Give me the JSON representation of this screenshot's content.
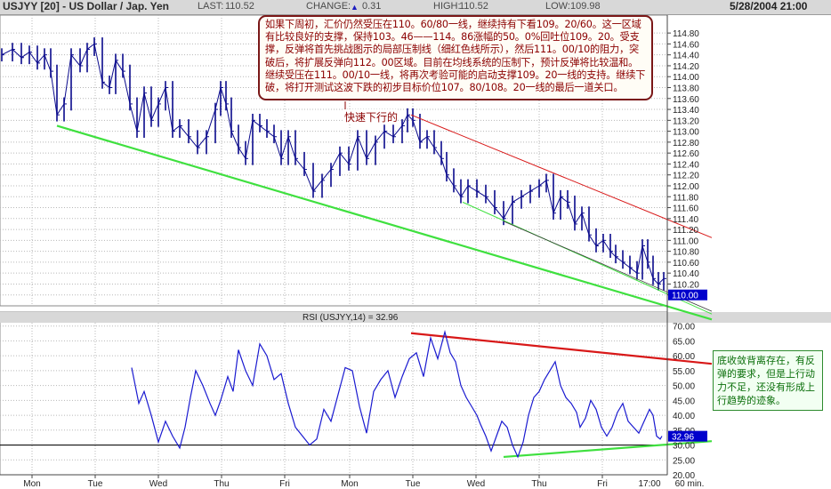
{
  "header": {
    "title": "USJYY [20] - US Dollar / Jap. Yen",
    "last_label": "LAST:",
    "last_value": "110.52",
    "change_label": "CHANGE:",
    "change_arrow": "▲",
    "change_value": "0.31",
    "high_label": "HIGH:",
    "high_value": "110.52",
    "low_label": "LOW:",
    "low_value": "109.98",
    "datetime": "5/28/2004 21:00"
  },
  "annotations": {
    "note_top": "如果下周初，汇价仍然受压在110。60/80一线，继续持有下看109。20/60。这一区域有比较良好的支撑，保持103。46——114。86涨幅的50。0%回吐位109。20。受支撑，反弹将首先挑战图示的局部压制线（细红色线所示），然后111。00/10的阻力，突破后，将扩展反弹向112。00区域。目前在均线系统的压制下，预计反弹将比较温和。继续受压在111。00/10一线，将再次考验可能的启动支撑109。20一线的支持。继续下破，将打开测试这波下跌的初步目标价位107。80/108。20一线的最后一道关口。",
    "fast_label": "快速下行的",
    "note_rsi": "底收敛背离存在，有反弹的要求，但是上行动力不足，还没有形成上行趋势的迹象。"
  },
  "colors": {
    "price": "#0a0a8c",
    "rsi": "#1a1ad0",
    "green_line": "#3fe03f",
    "red_line": "#d81818",
    "grid": "#b8b8b8",
    "highlight": "#0000cc"
  },
  "chart_data": [
    {
      "type": "bar",
      "subtype": "ohlc",
      "series": [
        {
          "name": "USJYY",
          "values": "see x / close (hourly)"
        }
      ],
      "x_labels": [
        "Mon",
        "Tue",
        "Wed",
        "Thu",
        "Fri",
        "Mon",
        "Tue",
        "Wed",
        "Thu",
        "Fri",
        "17:00",
        "60 min."
      ],
      "x": [
        0,
        12,
        22,
        31,
        40,
        48,
        55,
        62,
        70,
        78,
        88,
        96,
        104,
        113,
        121,
        128,
        136,
        144,
        152,
        160,
        168,
        176,
        184,
        192,
        200,
        210,
        220,
        230,
        240,
        246,
        252,
        258,
        266,
        274,
        282,
        290,
        298,
        306,
        314,
        322,
        330,
        340,
        350,
        360,
        370,
        380,
        390,
        400,
        410,
        420,
        430,
        440,
        450,
        456,
        462,
        470,
        478,
        486,
        494,
        500,
        508,
        516,
        524,
        534,
        544,
        554,
        564,
        574,
        584,
        594,
        604,
        612,
        620,
        628,
        636,
        644,
        652,
        660,
        668,
        676,
        684,
        690,
        698,
        706,
        714,
        720,
        726,
        732,
        738,
        744
      ],
      "close": [
        114.4,
        114.5,
        114.35,
        114.45,
        114.25,
        114.4,
        114.1,
        113.3,
        113.5,
        114.4,
        114.2,
        114.5,
        114.6,
        113.9,
        113.8,
        114.3,
        114.1,
        113.5,
        113.0,
        113.7,
        113.2,
        113.5,
        113.8,
        113.0,
        113.1,
        112.9,
        112.7,
        112.9,
        113.4,
        113.8,
        113.5,
        113.0,
        112.7,
        112.5,
        113.2,
        113.1,
        113.0,
        112.9,
        112.5,
        112.9,
        112.5,
        112.3,
        111.9,
        112.1,
        112.3,
        112.6,
        112.4,
        112.9,
        112.5,
        112.8,
        113.0,
        112.9,
        113.1,
        113.3,
        113.2,
        112.8,
        112.9,
        112.7,
        112.5,
        112.2,
        112.0,
        111.8,
        112.0,
        111.9,
        111.8,
        111.6,
        111.4,
        111.7,
        111.8,
        111.9,
        112.0,
        112.1,
        111.5,
        111.8,
        111.7,
        111.3,
        111.5,
        111.1,
        110.9,
        111.0,
        110.8,
        110.7,
        110.6,
        110.5,
        110.4,
        110.9,
        110.6,
        110.3,
        110.2,
        110.3
      ],
      "last": "110.00",
      "ylim": [
        109.8,
        114.9
      ],
      "y_ticks": [
        "114.80",
        "114.60",
        "114.40",
        "114.20",
        "114.00",
        "113.80",
        "113.60",
        "113.40",
        "113.20",
        "113.00",
        "112.80",
        "112.60",
        "112.40",
        "112.20",
        "112.00",
        "111.80",
        "111.60",
        "111.40",
        "111.20",
        "111.00",
        "110.80",
        "110.60",
        "110.40",
        "110.20",
        "110.00"
      ],
      "trendlines": [
        "green support",
        "red resistance",
        "thin green lower channel"
      ],
      "grid": true
    },
    {
      "type": "line",
      "title": "RSI (USJYY,14) = 32.96",
      "series": [
        {
          "name": "RSI (USJYY,14)",
          "values": [
            56,
            44,
            48,
            40,
            31,
            38,
            33,
            29,
            36,
            46,
            55,
            50,
            44,
            40,
            45,
            53,
            48,
            62,
            55,
            50,
            64,
            60,
            52,
            54,
            44,
            36,
            33,
            30,
            32,
            42,
            38,
            47,
            56,
            55,
            43,
            34,
            48,
            52,
            55,
            46,
            53,
            59,
            61,
            53,
            66,
            59,
            68,
            61,
            58,
            50,
            46,
            43,
            40,
            37,
            33,
            28,
            33,
            38,
            36,
            30,
            26,
            31,
            40,
            46,
            48,
            52,
            55,
            58,
            50,
            46,
            44,
            41,
            36,
            39,
            45,
            42,
            36,
            33,
            36,
            41,
            44,
            38,
            36,
            34,
            38,
            42,
            40,
            33,
            32,
            33
          ]
        }
      ],
      "x": [
        148,
        156,
        162,
        170,
        178,
        186,
        194,
        202,
        208,
        214,
        220,
        228,
        236,
        242,
        248,
        256,
        262,
        268,
        276,
        284,
        292,
        300,
        308,
        316,
        324,
        332,
        340,
        348,
        356,
        364,
        372,
        380,
        388,
        396,
        404,
        412,
        420,
        428,
        436,
        444,
        452,
        460,
        468,
        476,
        484,
        492,
        500,
        506,
        512,
        518,
        524,
        530,
        536,
        540,
        546,
        552,
        558,
        564,
        570,
        576,
        582,
        588,
        594,
        600,
        606,
        612,
        618,
        624,
        630,
        636,
        642,
        648,
        652,
        658,
        664,
        670,
        676,
        682,
        688,
        694,
        700,
        706,
        712,
        718,
        724,
        730,
        734,
        738,
        742,
        744
      ],
      "last": "32.96",
      "ylim": [
        20,
        72
      ],
      "y_ticks": [
        "70.00",
        "65.00",
        "60.00",
        "55.00",
        "50.00",
        "45.00",
        "40.00",
        "35.00",
        "30.00",
        "25.00",
        "20.00"
      ],
      "levels": [
        30
      ],
      "grid": true
    }
  ]
}
